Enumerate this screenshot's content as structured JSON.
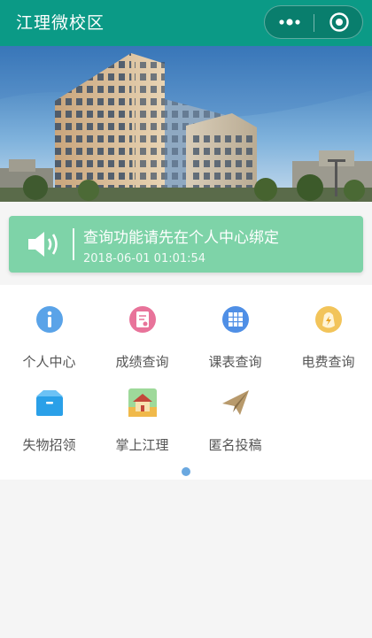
{
  "app": {
    "title": "江理微校区"
  },
  "capsule": {
    "more_icon": "more-dots-icon",
    "close_icon": "target-circle-icon"
  },
  "banner": {
    "description_icon": "campus-building-photo"
  },
  "notice": {
    "text": "查询功能请先在个人中心绑定",
    "time": "2018-06-01 01:01:54",
    "icon": "speaker-icon",
    "background": "#7ed3a8"
  },
  "menu": {
    "items": [
      {
        "label": "个人中心",
        "icon": "info-icon",
        "color": "#5aa3e8"
      },
      {
        "label": "成绩查询",
        "icon": "grade-report-icon",
        "color": "#e8739a"
      },
      {
        "label": "课表查询",
        "icon": "timetable-grid-icon",
        "color": "#4f8fe6"
      },
      {
        "label": "电费查询",
        "icon": "electricity-bill-icon",
        "color": "#f2c45a"
      },
      {
        "label": "失物招领",
        "icon": "lost-found-box-icon",
        "color": "#2aa0e8"
      },
      {
        "label": "掌上江理",
        "icon": "campus-home-icon",
        "color": "#f0b94a"
      },
      {
        "label": "匿名投稿",
        "icon": "paper-plane-icon",
        "color": "#b89a6c"
      }
    ]
  },
  "pager": {
    "active_index": 0,
    "total": 1
  }
}
